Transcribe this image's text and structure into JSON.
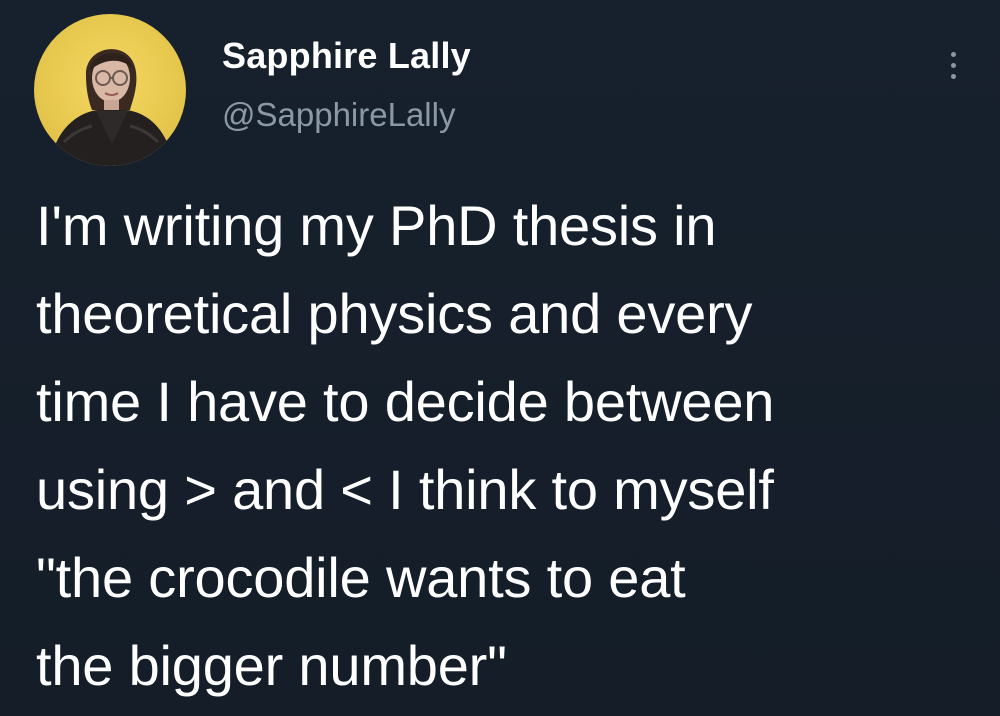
{
  "author": {
    "display_name": "Sapphire Lally",
    "handle": "@SapphireLally",
    "avatar_icon": "profile-photo"
  },
  "menu": {
    "icon": "vertical-ellipsis-icon"
  },
  "tweet": {
    "lines": [
      "I'm writing my PhD thesis in",
      "theoretical physics and every",
      "time I have to decide between",
      "using > and < I think to myself",
      "\"the crocodile wants to eat",
      "the bigger number\""
    ]
  },
  "colors": {
    "background": "#15202b",
    "primary_text": "#ffffff",
    "secondary_text": "#8b98a5",
    "avatar_background": "#e8c94f"
  }
}
